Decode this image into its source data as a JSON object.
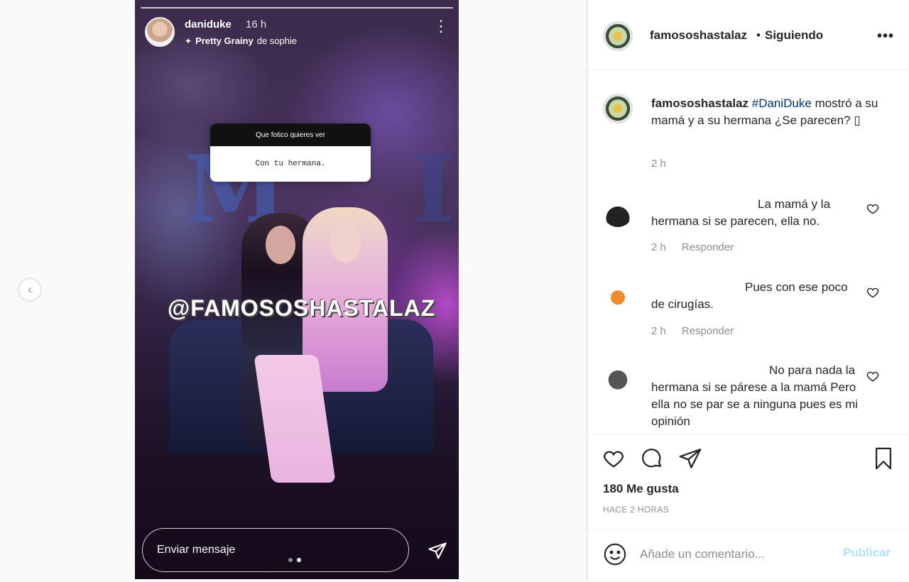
{
  "nav": {
    "prev_icon": "chevron-left-icon"
  },
  "story": {
    "username": "daniduke",
    "time": "16 h",
    "filter_name": "Pretty Grainy",
    "filter_author": "de sophie",
    "question_header": "Que fotico quieres ver",
    "question_answer": "Con tu hermana.",
    "watermark": "@FAMOSOSHASTALAZ",
    "reply_placeholder": "Enviar mensaje",
    "page_count": 2,
    "current_page": 2
  },
  "post": {
    "author": "famososhastalaz",
    "separator": "•",
    "follow_status": "Siguiendo",
    "caption": {
      "username": "famososhastalaz",
      "hashtag": "#DaniDuke",
      "text": " mostró a su mamá y a su hermana ¿Se parecen? ",
      "emoji": "▯",
      "time": "2 h"
    },
    "comments": [
      {
        "text": "La mamá y la hermana si se parecen, ella no.",
        "time": "2 h",
        "reply_label": "Responder"
      },
      {
        "text": "Pues con ese poco de cirugías.",
        "time": "2 h",
        "reply_label": "Responder"
      },
      {
        "text": "No para nada la hermana si se párese a la mamá Pero ella no se par se a ninguna pues es mi opinión"
      }
    ],
    "likes": "180 Me gusta",
    "posted_ago": "HACE 2 HORAS",
    "comment_placeholder": "Añade un comentario...",
    "publish_label": "Publicar"
  }
}
